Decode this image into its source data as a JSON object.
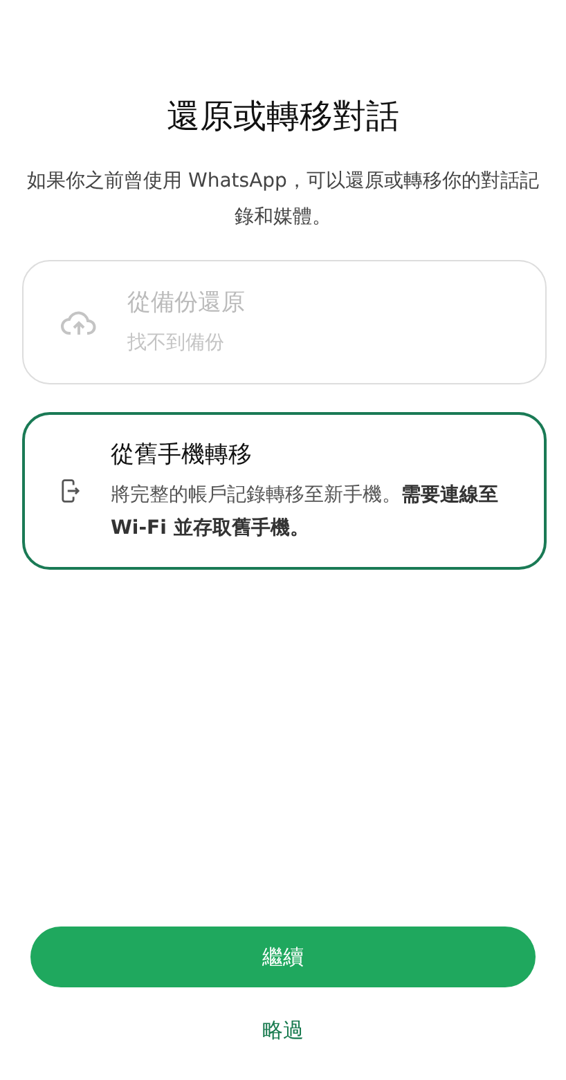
{
  "title": "還原或轉移對話",
  "subtitle": "如果你之前曾使用 WhatsApp，可以還原或轉移你的對話記錄和媒體。",
  "options": [
    {
      "kind": "cloud",
      "title": "從備份還原",
      "description": "找不到備份",
      "disabled": true,
      "selected": false
    },
    {
      "kind": "phone",
      "title": "從舊手機轉移",
      "description": "將完整的帳戶記錄轉移至新手機。**需要連線至 Wi-Fi 並存取舊手機。**",
      "disabled": false,
      "selected": true
    }
  ],
  "primary_button": "繼續",
  "secondary_button": "略過"
}
